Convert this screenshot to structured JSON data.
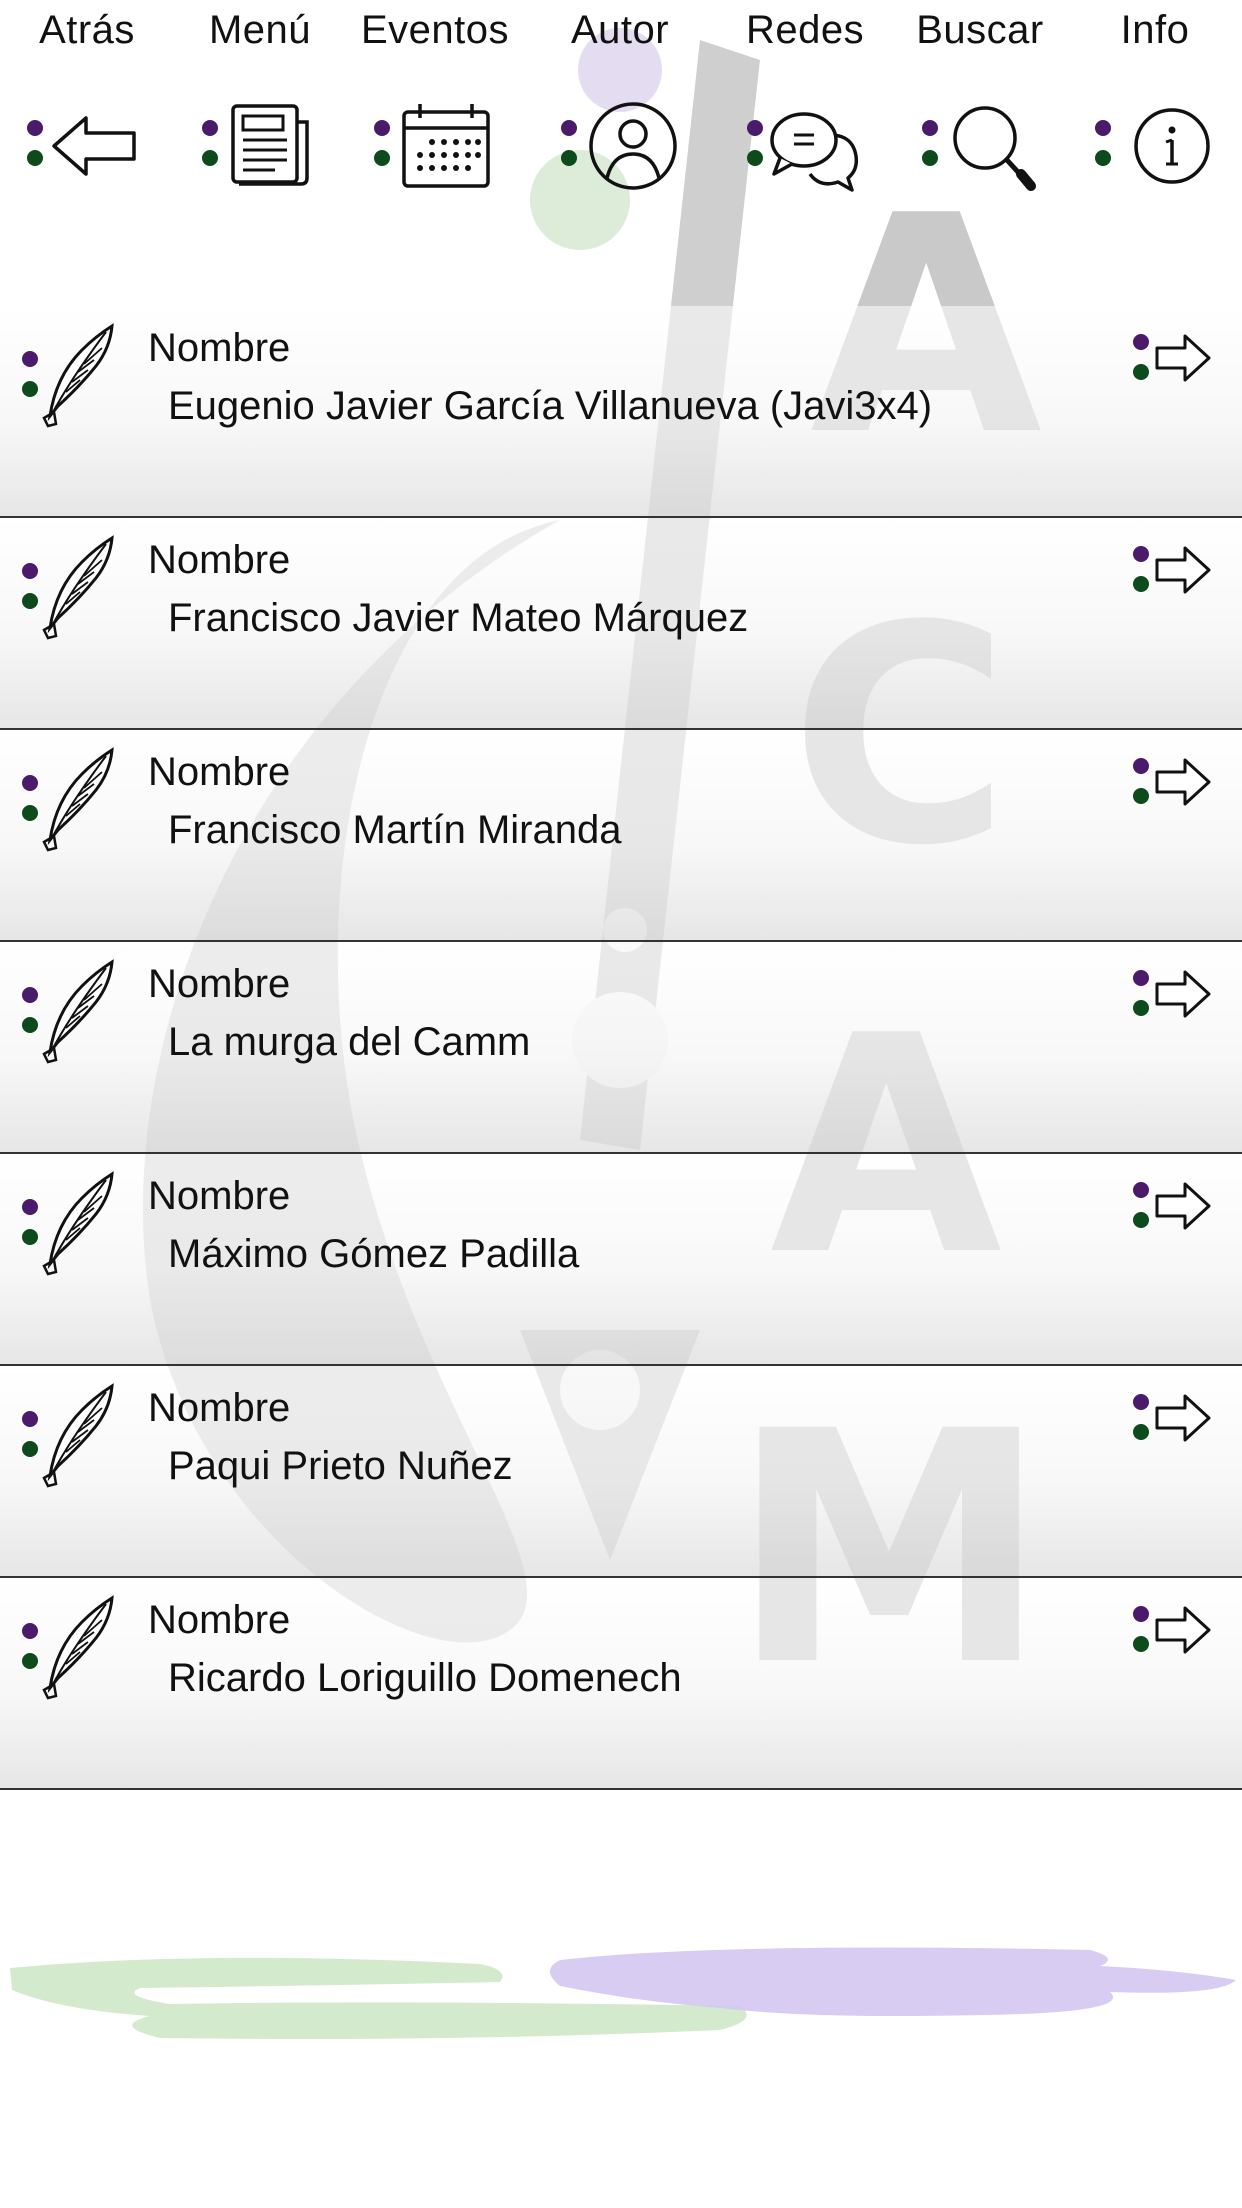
{
  "nav": {
    "items": [
      {
        "label": "Atrás",
        "icon": "back-arrow-icon"
      },
      {
        "label": "Menú",
        "icon": "newspaper-icon"
      },
      {
        "label": "Eventos",
        "icon": "calendar-icon"
      },
      {
        "label": "Autor",
        "icon": "user-icon"
      },
      {
        "label": "Redes",
        "icon": "chat-bubbles-icon"
      },
      {
        "label": "Buscar",
        "icon": "search-icon"
      },
      {
        "label": "Info",
        "icon": "info-icon"
      }
    ]
  },
  "list": {
    "field_label": "Nombre",
    "rows": [
      {
        "label": "Nombre",
        "name": "Eugenio Javier García Villanueva (Javi3x4)"
      },
      {
        "label": "Nombre",
        "name": "Francisco Javier Mateo Márquez"
      },
      {
        "label": "Nombre",
        "name": "Francisco Martín Miranda"
      },
      {
        "label": "Nombre",
        "name": "La murga del Camm"
      },
      {
        "label": "Nombre",
        "name": "Máximo Gómez Padilla"
      },
      {
        "label": "Nombre",
        "name": "Paqui Prieto Nuñez"
      },
      {
        "label": "Nombre",
        "name": "Ricardo Loriguillo Domenech"
      }
    ]
  },
  "colors": {
    "dot_purple": "#4a1a6b",
    "dot_green": "#0d4a1c",
    "divider": "#333333",
    "watermark": "#c9c9c9",
    "stroke_green": "#cfe8c8",
    "stroke_purple": "#d4c6f2"
  }
}
